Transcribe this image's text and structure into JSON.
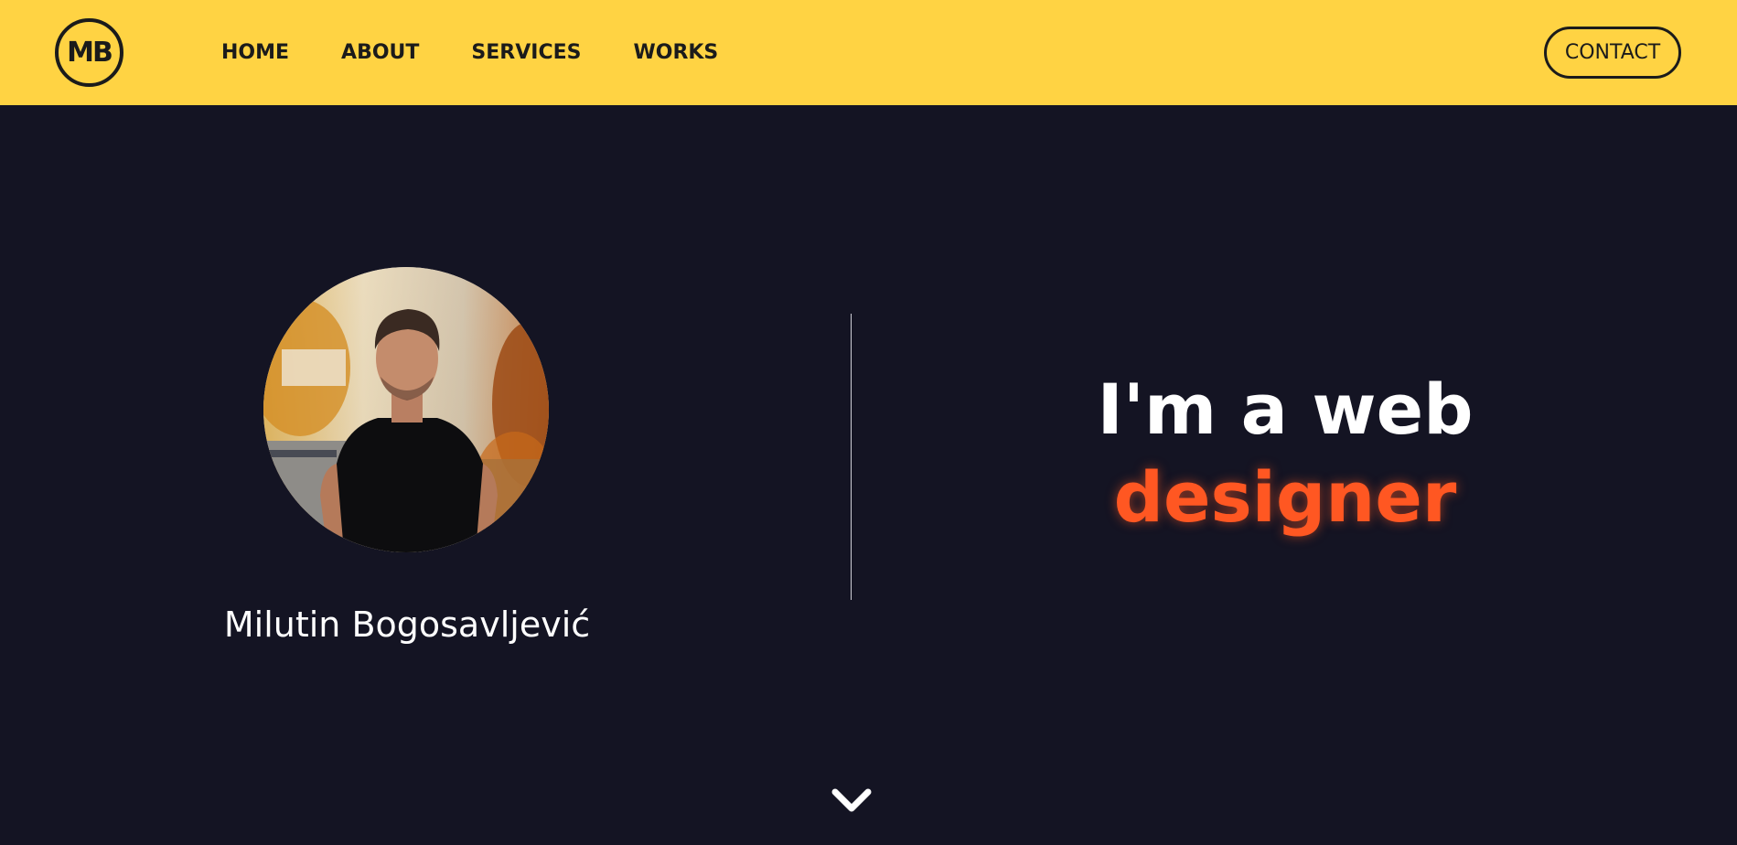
{
  "colors": {
    "nav_background": "#FFD343",
    "page_background": "#141423",
    "accent": "#FF5722",
    "text_light": "#ffffff",
    "text_dark": "#1b1b1b"
  },
  "nav": {
    "logo_text": "MB",
    "links": [
      {
        "label": "HOME"
      },
      {
        "label": "ABOUT"
      },
      {
        "label": "SERVICES"
      },
      {
        "label": "WORKS"
      }
    ],
    "contact_label": "CONTACT"
  },
  "profile": {
    "name": "Milutin Bogosavljević"
  },
  "hero": {
    "line1": "I'm a web",
    "line2": "designer"
  },
  "icons": {
    "scroll": "chevron-down-icon"
  }
}
